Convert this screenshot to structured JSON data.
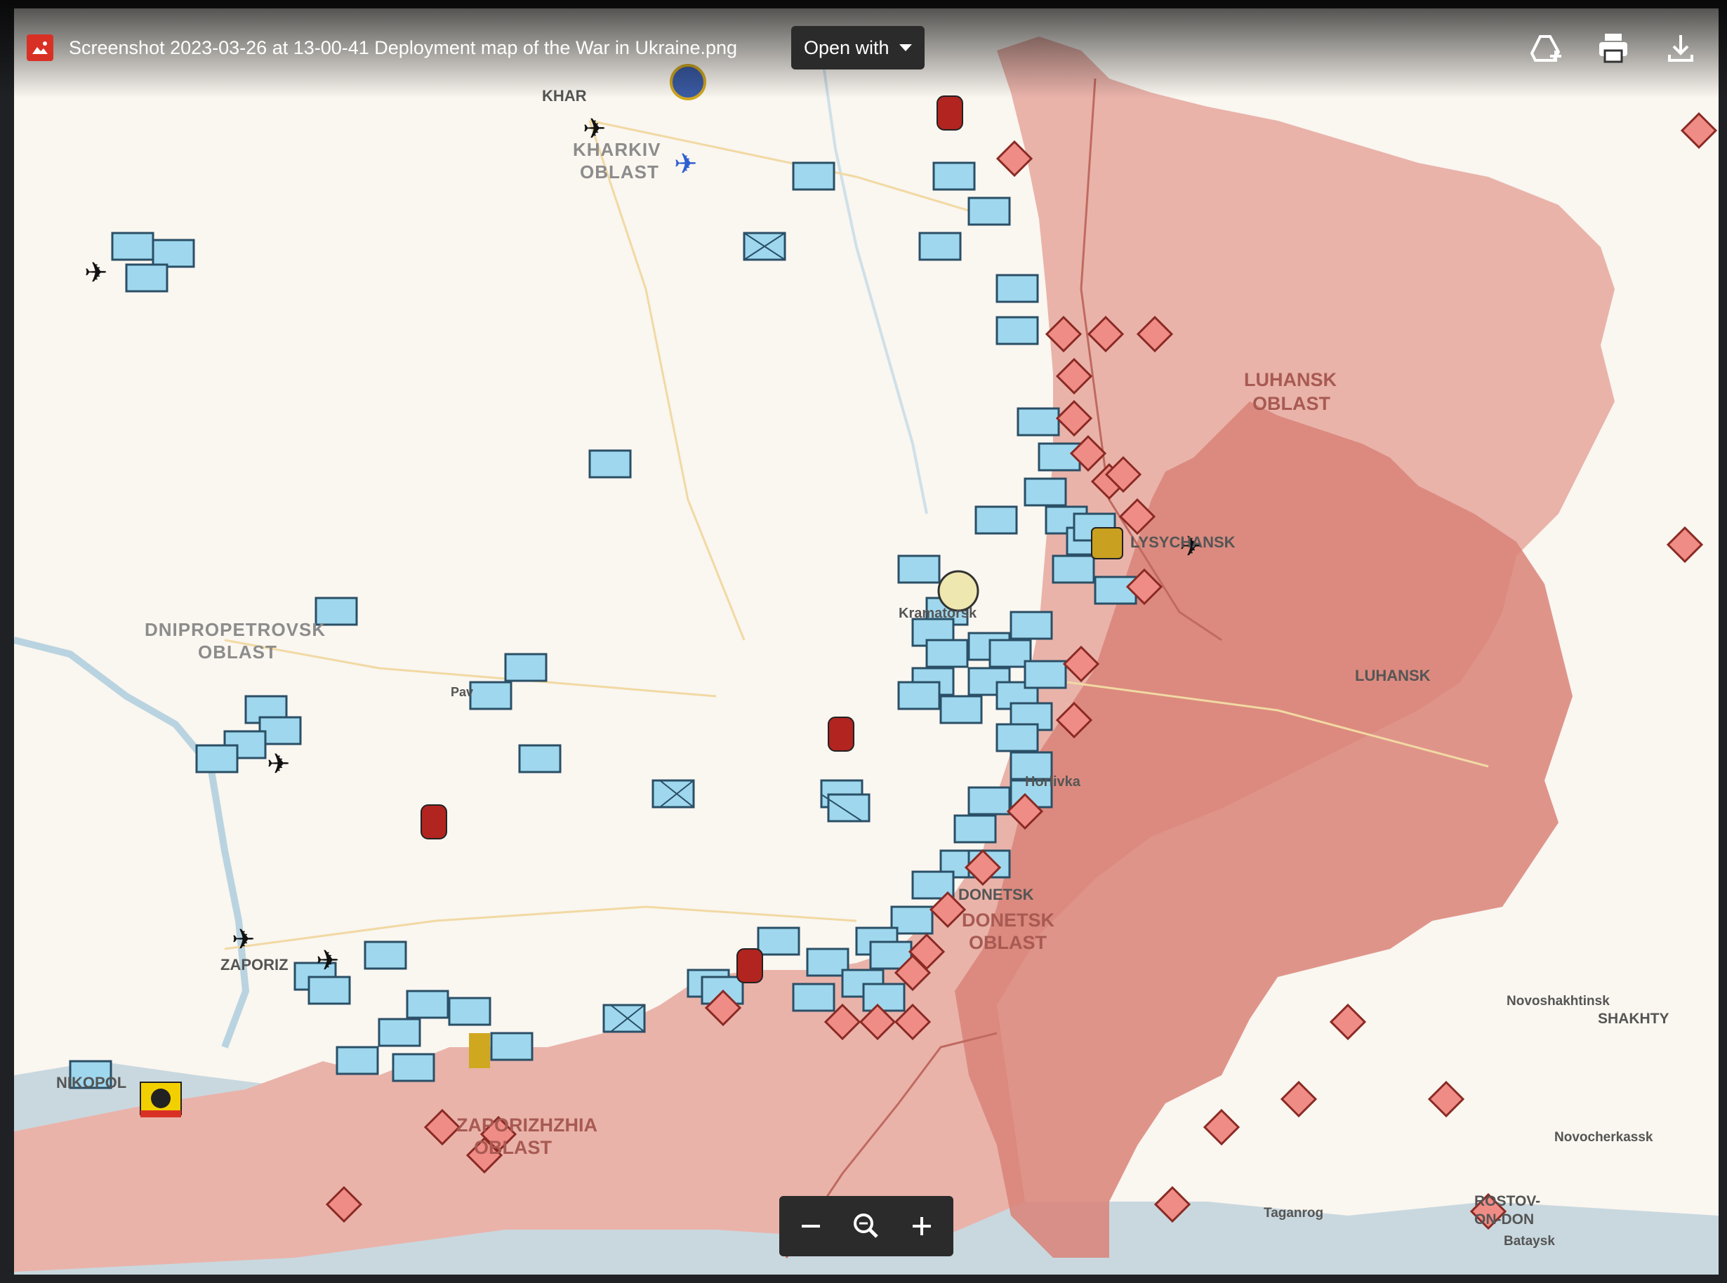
{
  "viewer": {
    "file_name": "Screenshot 2023-03-26 at 13-00-41 Deployment map of the War in Ukraine.png",
    "open_with_label": "Open with",
    "icons": [
      "image-file-icon",
      "add-to-drive-icon",
      "print-icon",
      "download-icon",
      "zoom-out-icon",
      "zoom-reset-icon",
      "zoom-in-icon"
    ]
  },
  "map": {
    "labels": {
      "kharkiv_oblast_1": "KHARKIV",
      "kharkiv_oblast_2": "OBLAST",
      "khar": "KHAR",
      "luhansk_oblast_1": "LUHANSK",
      "luhansk_oblast_2": "OBLAST",
      "luhansk": "LUHANSK",
      "dnipro_oblast_1": "DNIPROPETROVSK",
      "dnipro_oblast_2": "OBLAST",
      "donetsk": "DONETSK",
      "donetsk_oblast_1": "DONETSK",
      "donetsk_oblast_2": "OBLAST",
      "zapor_oblast_1": "ZAPORIZHZHIA",
      "zapor_oblast_2": "OBLAST",
      "zapor": "ZAPORIZ",
      "nikopol": "NIKOPOL",
      "horlivka": "Horlivka",
      "lysychansk": "LYSYCHANSK",
      "kramatorsk": "Kramatorsk",
      "pavlohrad": "Pav",
      "novoshakhtinsk": "Novoshakhtinsk",
      "shakhty": "SHAKHTY",
      "novocherkassk": "Novocherkassk",
      "taganrog": "Taganrog",
      "rostov_1": "ROSTOV-",
      "rostov_2": "ON-DON",
      "bataysk": "Bataysk"
    },
    "colors": {
      "land": "#faf6f0",
      "occupied": "#e9b3aa",
      "donetsk_luhansk_core": "#d98378",
      "sea": "#c9d8df",
      "ukr_unit": "#9fd8ee",
      "rus_unit": "#f08c86"
    }
  }
}
